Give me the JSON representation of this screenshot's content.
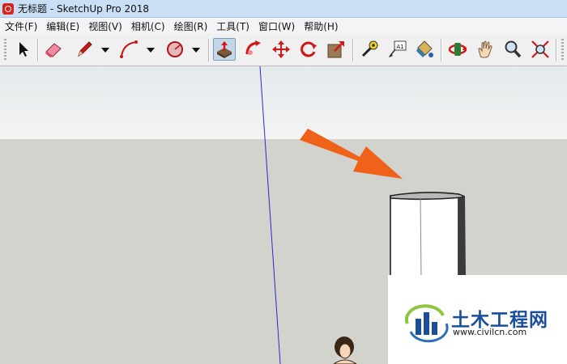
{
  "window": {
    "title": "无标题 - SketchUp Pro 2018"
  },
  "menubar": {
    "items": [
      "文件(F)",
      "编辑(E)",
      "视图(V)",
      "相机(C)",
      "绘图(R)",
      "工具(T)",
      "窗口(W)",
      "帮助(H)"
    ]
  },
  "toolbar": {
    "tools": [
      {
        "name": "select",
        "icon": "arrow-cursor-icon"
      },
      {
        "name": "eraser",
        "icon": "eraser-icon"
      },
      {
        "name": "line",
        "icon": "pencil-icon",
        "has_dropdown": true
      },
      {
        "name": "arc",
        "icon": "arc-icon",
        "has_dropdown": true
      },
      {
        "name": "shapes",
        "icon": "circle-shape-icon",
        "has_dropdown": true
      },
      {
        "name": "push-pull",
        "icon": "push-pull-icon",
        "active": true
      },
      {
        "name": "follow-me",
        "icon": "follow-me-icon"
      },
      {
        "name": "move",
        "icon": "move-icon"
      },
      {
        "name": "rotate",
        "icon": "rotate-icon"
      },
      {
        "name": "scale",
        "icon": "scale-icon"
      },
      {
        "name": "tape-measure",
        "icon": "tape-measure-icon"
      },
      {
        "name": "text",
        "icon": "text-label-icon",
        "label": "A1"
      },
      {
        "name": "paint-bucket",
        "icon": "paint-bucket-icon"
      },
      {
        "name": "orbit",
        "icon": "orbit-icon"
      },
      {
        "name": "pan",
        "icon": "hand-icon"
      },
      {
        "name": "zoom",
        "icon": "magnifier-icon"
      },
      {
        "name": "zoom-extents",
        "icon": "zoom-extents-icon"
      }
    ]
  },
  "colors": {
    "sky": "#eef1f0",
    "ground": "#d2d3cc",
    "axis_blue": "#2a2ad0",
    "arrow": "#f0621a",
    "active_tool": "#c5d6e8"
  },
  "watermark": {
    "brand_cn": "土木工程网",
    "url": "www.civilcn.com"
  }
}
